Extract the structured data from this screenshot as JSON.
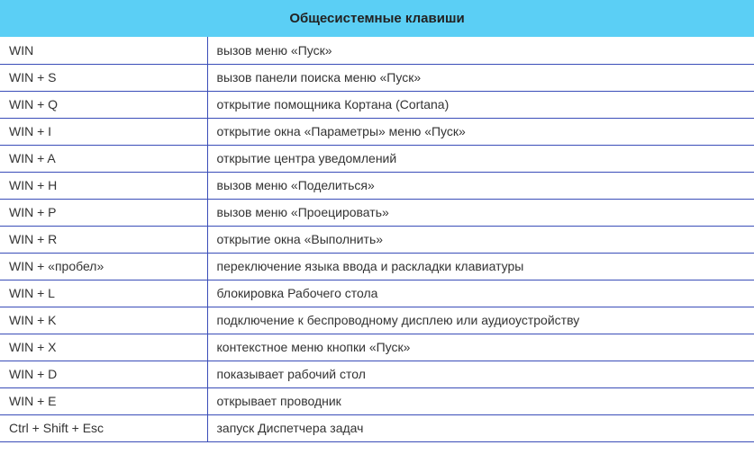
{
  "title": "Общесистемные клавиши",
  "rows": [
    {
      "key": "WIN",
      "desc": "вызов меню «Пуск»"
    },
    {
      "key": "WIN + S",
      "desc": "вызов панели поиска меню «Пуск»"
    },
    {
      "key": "WIN + Q",
      "desc": "открытие помощника Кортана (Cortana)"
    },
    {
      "key": "WIN + I",
      "desc": "открытие окна «Параметры» меню «Пуск»"
    },
    {
      "key": "WIN + A",
      "desc": "открытие центра уведомлений"
    },
    {
      "key": "WIN + H",
      "desc": "вызов меню «Поделиться»"
    },
    {
      "key": "WIN + P",
      "desc": "вызов меню «Проецировать»"
    },
    {
      "key": "WIN + R",
      "desc": "открытие окна «Выполнить»"
    },
    {
      "key": "WIN + «пробел»",
      "desc": "переключение языка ввода и раскладки клавиатуры"
    },
    {
      "key": "WIN + L",
      "desc": "блокировка Рабочего стола"
    },
    {
      "key": "WIN + K",
      "desc": "подключение к беспроводному дисплею или аудиоустройству"
    },
    {
      "key": "WIN + X",
      "desc": "контекстное меню кнопки «Пуск»"
    },
    {
      "key": "WIN + D",
      "desc": "показывает рабочий стол"
    },
    {
      "key": "WIN + E",
      "desc": "открывает проводник"
    },
    {
      "key": "Ctrl + Shift + Esc",
      "desc": "запуск Диспетчера задач"
    }
  ]
}
